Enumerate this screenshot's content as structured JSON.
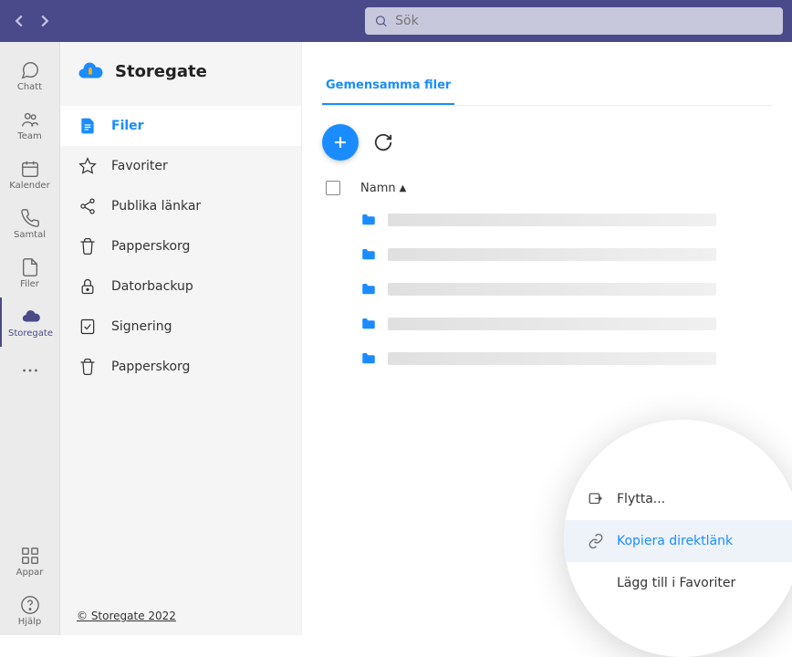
{
  "search": {
    "placeholder": "Sök"
  },
  "rail": {
    "items": [
      {
        "label": "Chatt"
      },
      {
        "label": "Team"
      },
      {
        "label": "Kalender"
      },
      {
        "label": "Samtal"
      },
      {
        "label": "Filer"
      },
      {
        "label": "Storegate"
      },
      {
        "label": ""
      }
    ],
    "bottom": [
      {
        "label": "Appar"
      },
      {
        "label": "Hjälp"
      }
    ]
  },
  "sidebar": {
    "title": "Storegate",
    "items": [
      {
        "label": "Filer"
      },
      {
        "label": "Favoriter"
      },
      {
        "label": "Publika länkar"
      },
      {
        "label": "Papperskorg"
      },
      {
        "label": "Datorbackup"
      },
      {
        "label": "Signering"
      },
      {
        "label": "Papperskorg"
      }
    ],
    "copyright": "© Storegate 2022"
  },
  "content": {
    "tab": "Gemensamma filer",
    "column_name": "Namn"
  },
  "context_menu": {
    "move": "Flytta...",
    "copy_link": "Kopiera direktlänk",
    "add_fav": "Lägg till i Favoriter"
  }
}
